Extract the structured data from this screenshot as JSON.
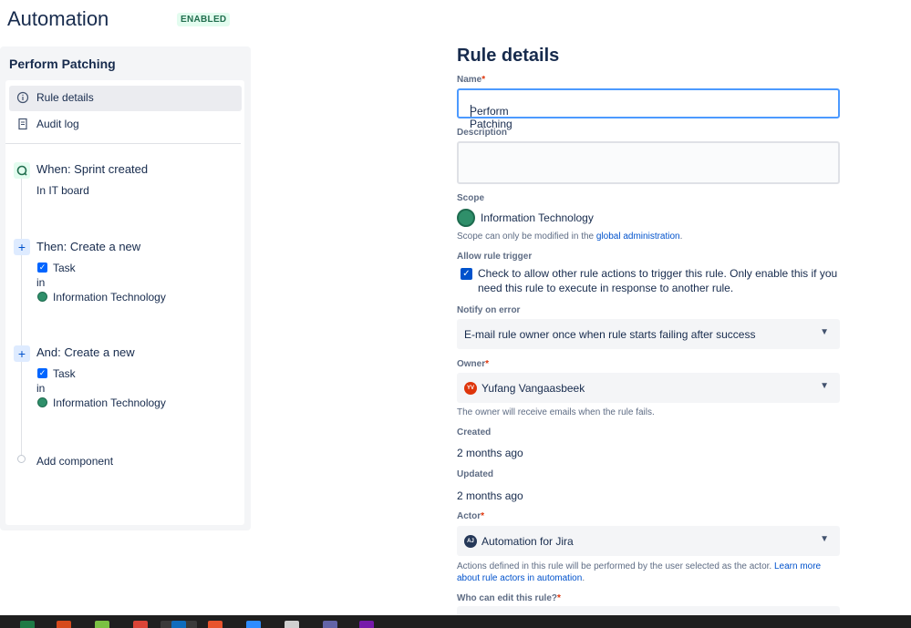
{
  "header": {
    "title": "Automation",
    "status_badge": "ENABLED"
  },
  "sidebar": {
    "rule_name": "Perform Patching",
    "nav": [
      {
        "label": "Rule details",
        "icon": "info-icon",
        "active": true
      },
      {
        "label": "Audit log",
        "icon": "document-icon",
        "active": false
      }
    ],
    "steps": [
      {
        "icon": "trigger-icon",
        "title": "When: Sprint created",
        "detail": "In IT board"
      },
      {
        "icon": "plus-icon",
        "title": "Then: Create a new",
        "issue_type": "Task",
        "connector": "in",
        "project": "Information Technology"
      },
      {
        "icon": "plus-icon",
        "title": "And: Create a new",
        "issue_type": "Task",
        "connector": "in",
        "project": "Information Technology"
      }
    ],
    "add_component": "Add component"
  },
  "form": {
    "heading": "Rule details",
    "name": {
      "label": "Name",
      "required": "*",
      "value": "Perform Patching"
    },
    "description": {
      "label": "Description",
      "value": ""
    },
    "scope": {
      "label": "Scope",
      "value": "Information Technology",
      "help_prefix": "Scope can only be modified in the ",
      "help_link": "global administration",
      "help_suffix": "."
    },
    "allow_trigger": {
      "label": "Allow rule trigger",
      "checked": true,
      "text": "Check to allow other rule actions to trigger this rule. Only enable this if you need this rule to execute in response to another rule."
    },
    "notify": {
      "label": "Notify on error",
      "value": "E-mail rule owner once when rule starts failing after success"
    },
    "owner": {
      "label": "Owner",
      "required": "*",
      "avatar_initials": "YV",
      "value": "Yufang Vangaasbeek",
      "help": "The owner will receive emails when the rule fails."
    },
    "created": {
      "label": "Created",
      "value": "2 months ago"
    },
    "updated": {
      "label": "Updated",
      "value": "2 months ago"
    },
    "actor": {
      "label": "Actor",
      "required": "*",
      "avatar_initials": "AJ",
      "value": "Automation for Jira",
      "help_prefix": "Actions defined in this rule will be performed by the user selected as the actor. ",
      "help_link": "Learn more about rule actors in automation",
      "help_suffix": "."
    },
    "who_can_edit": {
      "label": "Who can edit this rule?",
      "required": "*"
    }
  },
  "colors": {
    "accent": "#0052cc",
    "focus_border": "#4c9aff",
    "enabled_badge": "#216e4e",
    "owner_avatar": "#de350b",
    "actor_avatar": "#253858",
    "scope_globe": "#2f8f6a"
  },
  "taskbar": {
    "icons": [
      "excel-icon",
      "office-icon",
      "notepad-icon",
      "chrome-icon",
      "outlook-icon",
      "puzzle-icon",
      "zoom-icon",
      "files-icon",
      "teams-icon",
      "onenote-icon"
    ]
  }
}
